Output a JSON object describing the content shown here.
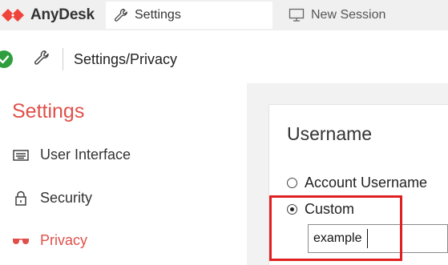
{
  "app": {
    "name": "AnyDesk",
    "brand_color": "#e0504a"
  },
  "tabs": [
    {
      "label": "Settings",
      "icon": "wrench-icon",
      "active": true
    },
    {
      "label": "New Session",
      "icon": "monitor-icon",
      "active": false
    }
  ],
  "address": {
    "path": "Settings/Privacy",
    "status_icon": "check-circle-icon",
    "status_color": "#2e9e3e"
  },
  "sidebar": {
    "title": "Settings",
    "items": [
      {
        "label": "User Interface",
        "icon": "keyboard-icon"
      },
      {
        "label": "Security",
        "icon": "lock-icon"
      },
      {
        "label": "Privacy",
        "icon": "glasses-icon",
        "active": true
      }
    ]
  },
  "username_section": {
    "title": "Username",
    "options": [
      {
        "label": "Account Username",
        "checked": false
      },
      {
        "label": "Custom",
        "checked": true
      }
    ],
    "custom_value": "example"
  },
  "annotation": {
    "color": "#e02020"
  }
}
